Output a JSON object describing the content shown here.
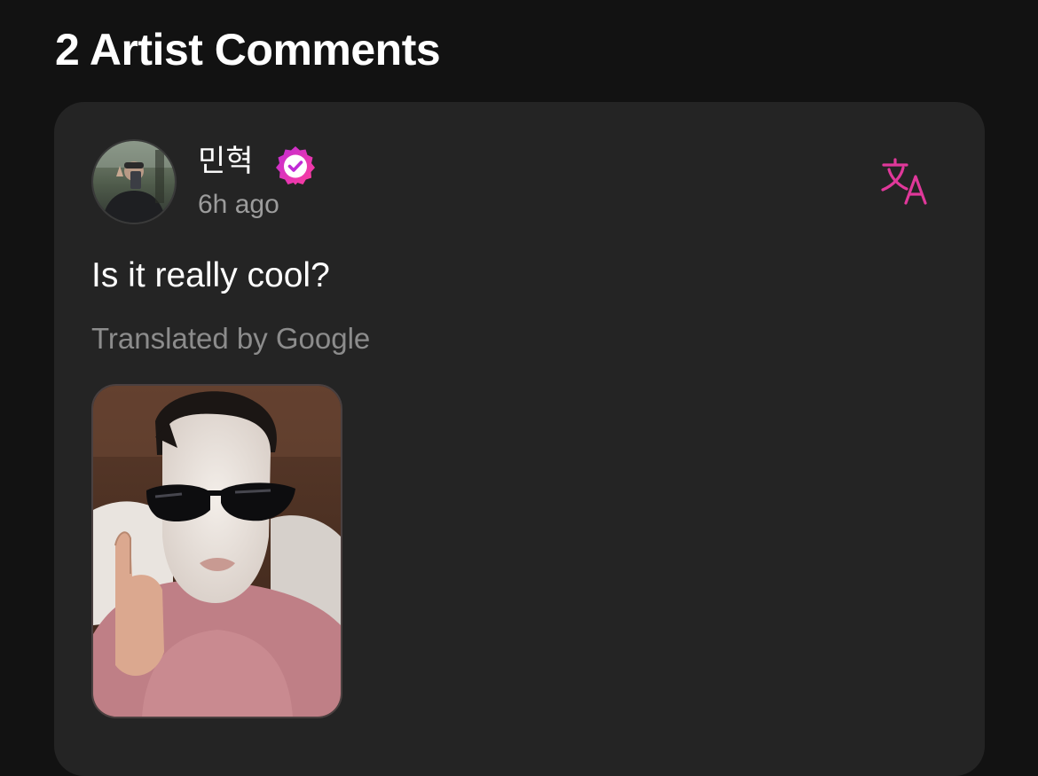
{
  "section": {
    "title": "2 Artist Comments"
  },
  "comment": {
    "author": "민혁",
    "time": "6h ago",
    "text": "Is it really cool?",
    "translated_note": "Translated by Google",
    "avatar_icon": "avatar-photo",
    "verified_icon": "verified-badge-icon",
    "translate_icon": "translate-icon",
    "accent_color": "#e0389a",
    "badge_gradient": [
      "#c02bd6",
      "#ff3e9a"
    ]
  }
}
